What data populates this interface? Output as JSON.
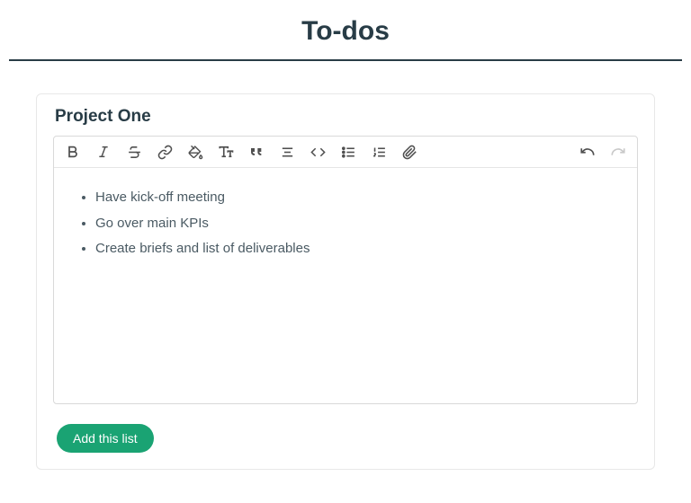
{
  "page": {
    "title": "To-dos"
  },
  "list": {
    "title": "Project One",
    "items": [
      "Have kick-off meeting",
      "Go over main KPIs",
      "Create briefs and list of deliverables"
    ]
  },
  "toolbar": {
    "bold": "Bold",
    "italic": "Italic",
    "strike": "Strikethrough",
    "link": "Link",
    "highlight": "Highlight color",
    "textsize": "Text size",
    "quote": "Quote",
    "align": "Align",
    "code": "Code",
    "bulleted": "Bulleted list",
    "numbered": "Numbered list",
    "attach": "Attach file",
    "undo": "Undo",
    "redo": "Redo"
  },
  "actions": {
    "add_list": "Add this list"
  }
}
